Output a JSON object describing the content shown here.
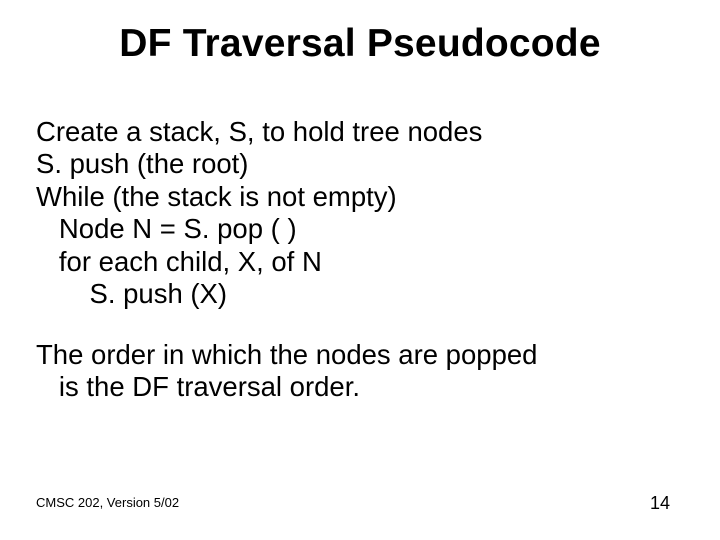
{
  "title": "DF Traversal Pseudocode",
  "code": [
    "Create a stack, S, to hold tree nodes",
    "S. push (the root)",
    "While (the stack is not empty)",
    "   Node N = S. pop ( )",
    "   for each child, X, of N",
    "       S. push (X)"
  ],
  "explain": [
    "The order in which the nodes are popped",
    "   is the DF traversal order."
  ],
  "footer": {
    "left": "CMSC 202, Version 5/02",
    "page": "14"
  }
}
